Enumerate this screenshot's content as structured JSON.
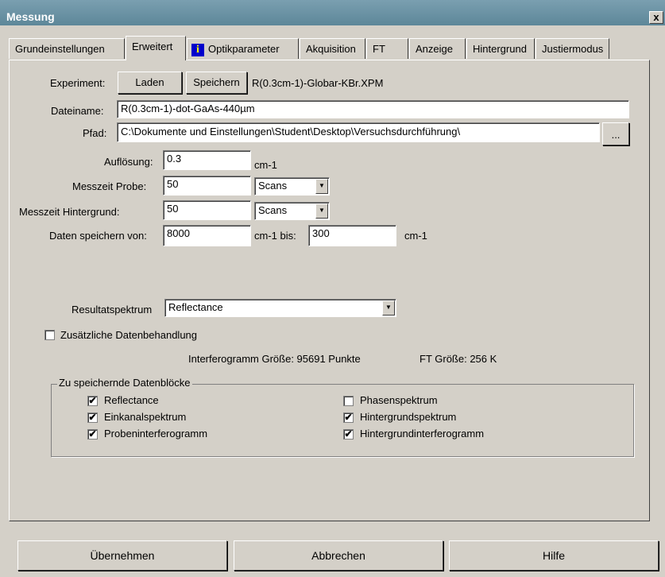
{
  "window": {
    "title": "Messung",
    "close_glyph": "x"
  },
  "tabs": [
    {
      "label": "Grundeinstellungen"
    },
    {
      "label": "Erweitert"
    },
    {
      "label": "Optikparameter"
    },
    {
      "label": "Akquisition"
    },
    {
      "label": "FT"
    },
    {
      "label": "Anzeige"
    },
    {
      "label": "Hintergrund"
    },
    {
      "label": "Justiermodus"
    }
  ],
  "info_icon_glyph": "i",
  "experiment": {
    "label": "Experiment:",
    "load_button": "Laden",
    "save_button": "Speichern",
    "file": "R(0.3cm-1)-Globar-KBr.XPM"
  },
  "filename": {
    "label": "Dateiname:",
    "value": "R(0.3cm-1)-dot-GaAs-440µm"
  },
  "path": {
    "label": "Pfad:",
    "value": "C:\\Dokumente und Einstellungen\\Student\\Desktop\\Versuchsdurchführung\\",
    "browse": "..."
  },
  "resolution": {
    "label": "Auflösung:",
    "value": "0.3",
    "unit": "cm-1"
  },
  "sample_time": {
    "label": "Messzeit Probe:",
    "value": "50",
    "unit": "Scans"
  },
  "bg_time": {
    "label": "Messzeit Hintergrund:",
    "value": "50",
    "unit": "Scans"
  },
  "save_range": {
    "label": "Daten speichern von:",
    "from": "8000",
    "mid_label": "cm-1 bis:",
    "to": "300",
    "unit": "cm-1"
  },
  "result": {
    "label": "Resultatspektrum",
    "value": "Reflectance"
  },
  "extra": {
    "label": "Zusätzliche Datenbehandlung",
    "checked": false
  },
  "info": {
    "interferogram": "Interferogramm Größe: 95691 Punkte",
    "ft": "FT Größe: 256 K"
  },
  "blocks": {
    "title": "Zu speichernde Datenblöcke",
    "items": [
      {
        "label": "Reflectance",
        "checked": true,
        "mark": "✔"
      },
      {
        "label": "Einkanalspektrum",
        "checked": true,
        "mark": "✔"
      },
      {
        "label": "Probeninterferogramm",
        "checked": true,
        "mark": "✔"
      },
      {
        "label": "Phasenspektrum",
        "checked": false,
        "mark": ""
      },
      {
        "label": "Hintergrundspektrum",
        "checked": true,
        "mark": "✔"
      },
      {
        "label": "Hintergrundinterferogramm",
        "checked": true,
        "mark": "✔"
      }
    ]
  },
  "footer": {
    "apply": "Übernehmen",
    "cancel": "Abbrechen",
    "help": "Hilfe"
  }
}
